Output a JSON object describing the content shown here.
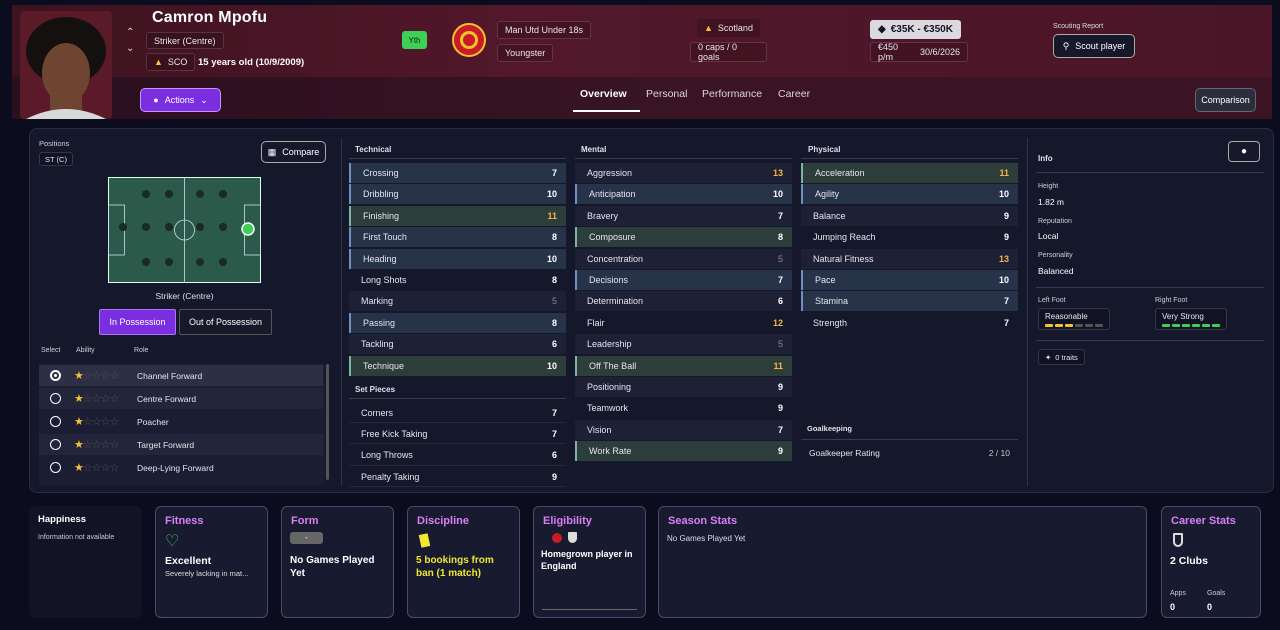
{
  "player": {
    "name": "Camron Mpofu",
    "position": "Striker (Centre)",
    "nation_code": "SCO",
    "age_text": "15 years old (10/9/2009)",
    "youth_badge": "Yth",
    "club": "Man Utd Under 18s",
    "club_role": "Youngster",
    "nation": "Scotland",
    "caps": "0 caps / 0 goals",
    "value": "€35K - €350K",
    "wage": "€450 p/m",
    "contract_end": "30/6/2026"
  },
  "header": {
    "scouting_title": "Scouting Report",
    "scout_button": "Scout player",
    "actions_button": "Actions",
    "comparison_button": "Comparison",
    "tabs": [
      "Overview",
      "Personal",
      "Performance",
      "Career"
    ],
    "active_tab": "Overview"
  },
  "positions": {
    "title": "Positions",
    "badge": "ST (C)",
    "compare_button": "Compare",
    "pitch_label": "Striker (Centre)",
    "toggle": [
      "In Possession",
      "Out of Possession"
    ],
    "role_headers": [
      "Select",
      "Ability",
      "Role"
    ],
    "roles": [
      {
        "name": "Channel Forward",
        "stars": 1,
        "selected": true
      },
      {
        "name": "Centre Forward",
        "stars": 1,
        "selected": false
      },
      {
        "name": "Poacher",
        "stars": 1,
        "selected": false
      },
      {
        "name": "Target Forward",
        "stars": 1,
        "selected": false
      },
      {
        "name": "Deep-Lying Forward",
        "stars": 1,
        "selected": false
      }
    ]
  },
  "technical": {
    "title": "Technical",
    "items": [
      {
        "name": "Crossing",
        "value": "7"
      },
      {
        "name": "Dribbling",
        "value": "10"
      },
      {
        "name": "Finishing",
        "value": "11"
      },
      {
        "name": "First Touch",
        "value": "8"
      },
      {
        "name": "Heading",
        "value": "10"
      },
      {
        "name": "Long Shots",
        "value": "8"
      },
      {
        "name": "Marking",
        "value": "5"
      },
      {
        "name": "Passing",
        "value": "8"
      },
      {
        "name": "Tackling",
        "value": "6"
      },
      {
        "name": "Technique",
        "value": "10"
      }
    ]
  },
  "set_pieces": {
    "title": "Set Pieces",
    "items": [
      {
        "name": "Corners",
        "value": "7"
      },
      {
        "name": "Free Kick Taking",
        "value": "7"
      },
      {
        "name": "Long Throws",
        "value": "6"
      },
      {
        "name": "Penalty Taking",
        "value": "9"
      }
    ]
  },
  "mental": {
    "title": "Mental",
    "items": [
      {
        "name": "Aggression",
        "value": "13"
      },
      {
        "name": "Anticipation",
        "value": "10"
      },
      {
        "name": "Bravery",
        "value": "7"
      },
      {
        "name": "Composure",
        "value": "8"
      },
      {
        "name": "Concentration",
        "value": "5"
      },
      {
        "name": "Decisions",
        "value": "7"
      },
      {
        "name": "Determination",
        "value": "6"
      },
      {
        "name": "Flair",
        "value": "12"
      },
      {
        "name": "Leadership",
        "value": "5"
      },
      {
        "name": "Off The Ball",
        "value": "11"
      },
      {
        "name": "Positioning",
        "value": "9"
      },
      {
        "name": "Teamwork",
        "value": "9"
      },
      {
        "name": "Vision",
        "value": "7"
      },
      {
        "name": "Work Rate",
        "value": "9"
      }
    ]
  },
  "physical": {
    "title": "Physical",
    "items": [
      {
        "name": "Acceleration",
        "value": "11"
      },
      {
        "name": "Agility",
        "value": "10"
      },
      {
        "name": "Balance",
        "value": "9"
      },
      {
        "name": "Jumping Reach",
        "value": "9"
      },
      {
        "name": "Natural Fitness",
        "value": "13"
      },
      {
        "name": "Pace",
        "value": "10"
      },
      {
        "name": "Stamina",
        "value": "7"
      },
      {
        "name": "Strength",
        "value": "7"
      }
    ]
  },
  "goalkeeping": {
    "title": "Goalkeeping",
    "label": "Goalkeeper Rating",
    "value": "2 / 10"
  },
  "info": {
    "title": "Info",
    "height_label": "Height",
    "height": "1.82 m",
    "reputation_label": "Reputation",
    "reputation": "Local",
    "personality_label": "Personality",
    "personality": "Balanced",
    "left_foot_label": "Left Foot",
    "left_foot": "Reasonable",
    "left_foot_level": 3,
    "right_foot_label": "Right Foot",
    "right_foot": "Very Strong",
    "right_foot_level": 6,
    "traits": "0 traits"
  },
  "cards": {
    "happiness": {
      "title": "Happiness",
      "text": "Information not available"
    },
    "fitness": {
      "title": "Fitness",
      "status": "Excellent",
      "sub": "Severely lacking in mat..."
    },
    "form": {
      "title": "Form",
      "badge": "-",
      "text": "No Games Played Yet"
    },
    "discipline": {
      "title": "Discipline",
      "text": "5 bookings from ban (1 match)"
    },
    "eligibility": {
      "title": "Eligibility",
      "text": "Homegrown player in England"
    },
    "season": {
      "title": "Season Stats",
      "text": "No Games Played Yet"
    },
    "career": {
      "title": "Career Stats",
      "clubs": "2 Clubs",
      "apps_label": "Apps",
      "apps": "0",
      "goals_label": "Goals",
      "goals": "0"
    }
  },
  "colors": {
    "accent": "#7a2ee0",
    "highlight_orange": "#f2b642",
    "card_title": "#d880f2",
    "header_bg": "#4a1627"
  }
}
